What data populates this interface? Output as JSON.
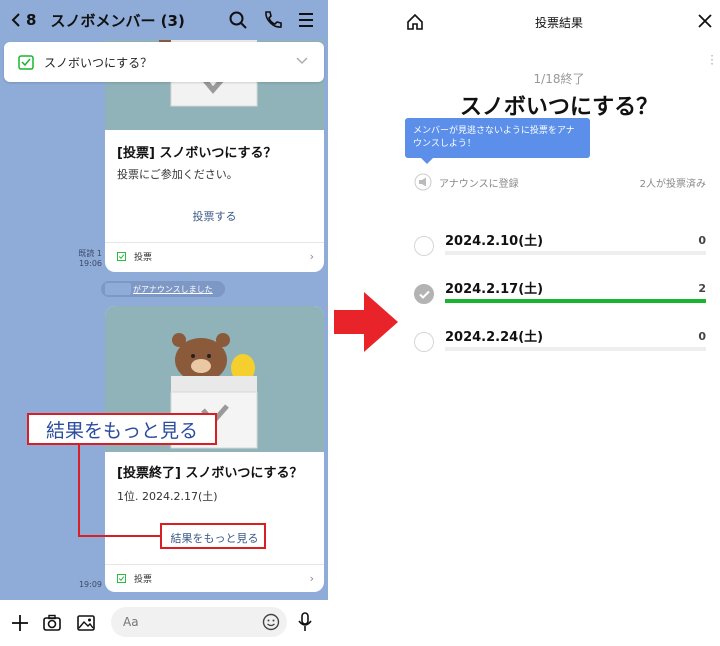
{
  "chat": {
    "back_count": "8",
    "title": "スノボメンバー (3)",
    "announcement": "スノボいつにする？",
    "card1": {
      "title": "[投票] スノボいつにする？",
      "subtitle": "投票にご参加ください。",
      "action": "投票する",
      "footer": "投票",
      "read": "既読 1",
      "time": "19:06"
    },
    "system_message": "がアナウンスしました",
    "card2": {
      "title": "[投票終了] スノボいつにする？",
      "subtitle": "1位. 2024.2.17(土)",
      "action": "結果をもっと見る",
      "footer": "投票",
      "time": "19:09"
    },
    "callout": "結果をもっと見る",
    "input_placeholder": "Aa"
  },
  "poll": {
    "header_title": "投票結果",
    "deadline": "1/18終了",
    "question": "スノボいつにする？",
    "tooltip": "メンバーが見逃さないように投票をアナウンスしよう！",
    "announce_label": "アナウンスに登録",
    "voted_count": "2人が投票済み",
    "options": [
      {
        "label": "2024.2.10(土)",
        "votes": "0",
        "share": 0,
        "selected": false
      },
      {
        "label": "2024.2.17(土)",
        "votes": "2",
        "share": 1,
        "selected": true
      },
      {
        "label": "2024.2.24(土)",
        "votes": "0",
        "share": 0,
        "selected": false
      }
    ]
  },
  "colors": {
    "chat_bg": "#8fabd8",
    "accent_red": "#d81f26",
    "vote_bar": "#17b530",
    "tooltip": "#5b8fe9",
    "link": "#3b5a86"
  }
}
